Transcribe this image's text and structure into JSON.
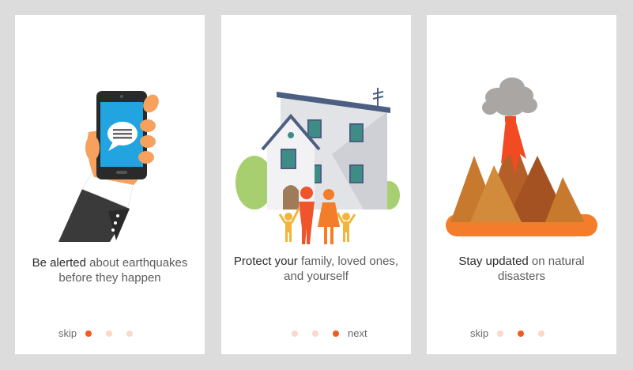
{
  "colors": {
    "background": "#dcdcdc",
    "card": "#ffffff",
    "accent": "#f25a22",
    "dot_inactive": "#fbd8cb"
  },
  "cards": [
    {
      "illustration": "phone-in-hand-icon",
      "caption": {
        "em1": "Be alerted",
        "rest1": " about earthquakes before they happen"
      },
      "nav": {
        "skip": "skip",
        "active_page": 1,
        "pages": 3
      }
    },
    {
      "illustration": "house-family-icon",
      "caption": {
        "em1": "Protect your",
        "rest1": " family, loved ones, and yourself"
      },
      "nav": {
        "next": "next",
        "active_page": 3,
        "pages": 3
      }
    },
    {
      "illustration": "volcano-icon",
      "caption": {
        "em1": "Stay updated",
        "rest1": " on natural disasters"
      },
      "nav": {
        "skip": "skip",
        "active_page": 2,
        "pages": 3
      }
    }
  ]
}
